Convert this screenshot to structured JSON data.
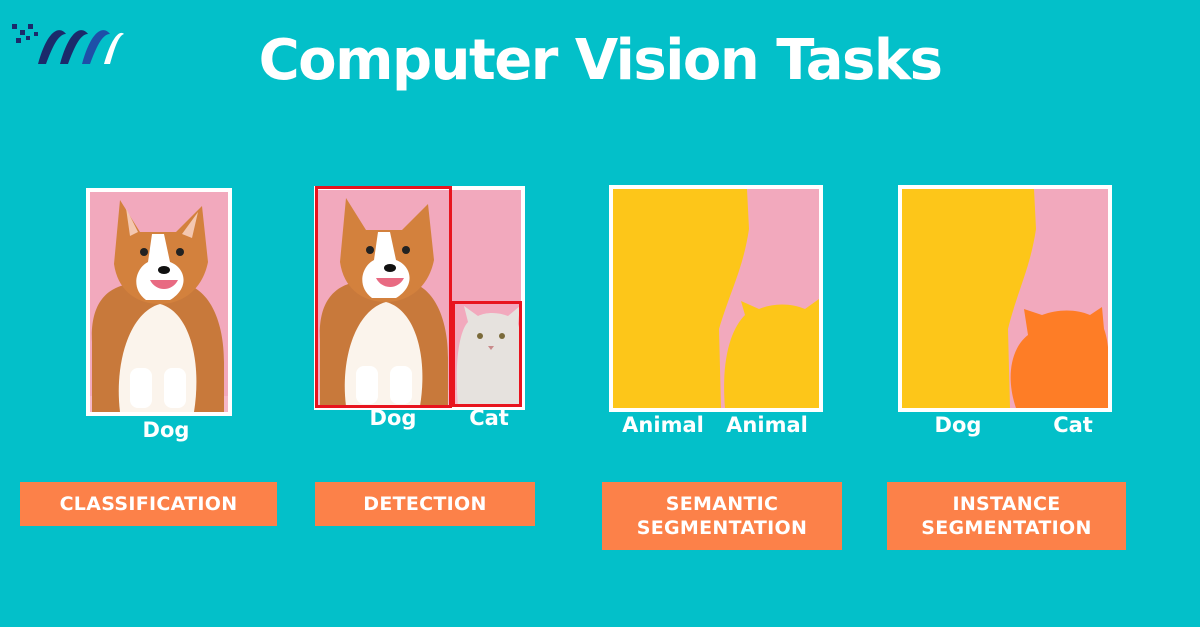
{
  "title": "Computer Vision Tasks",
  "colors": {
    "background": "#03c0c9",
    "badge": "#fc8149",
    "box": "#e8141e",
    "mask_yellow": "#fdc619",
    "mask_orange": "#fe7d26",
    "photo_pink": "#f2a9bd"
  },
  "tasks": [
    {
      "name": "CLASSIFICATION",
      "labels": [
        "Dog"
      ]
    },
    {
      "name": "DETECTION",
      "labels": [
        "Dog",
        "Cat"
      ]
    },
    {
      "name": "SEMANTIC SEGMENTATION",
      "labels": [
        "Animal",
        "Animal"
      ]
    },
    {
      "name": "INSTANCE SEGMENTATION",
      "labels": [
        "Dog",
        "Cat"
      ]
    }
  ]
}
